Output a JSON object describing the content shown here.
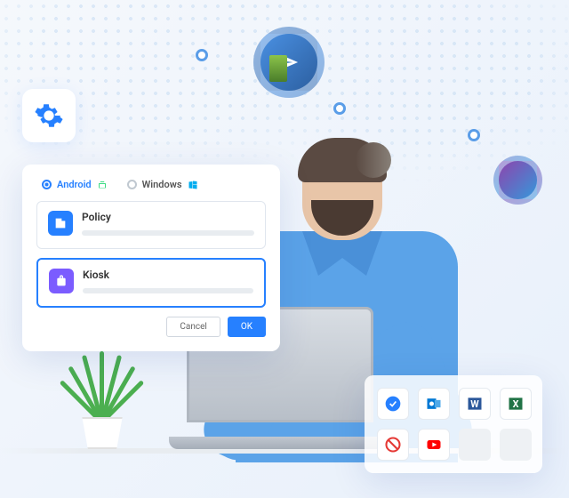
{
  "os_tabs": {
    "android": "Android",
    "windows": "Windows"
  },
  "options": {
    "policy": {
      "label": "Policy"
    },
    "kiosk": {
      "label": "Kiosk"
    }
  },
  "buttons": {
    "cancel": "Cancel",
    "ok": "OK"
  },
  "apps": {
    "allowed": [
      "check",
      "outlook",
      "word",
      "excel"
    ],
    "blocked": [
      "block",
      "youtube"
    ]
  }
}
